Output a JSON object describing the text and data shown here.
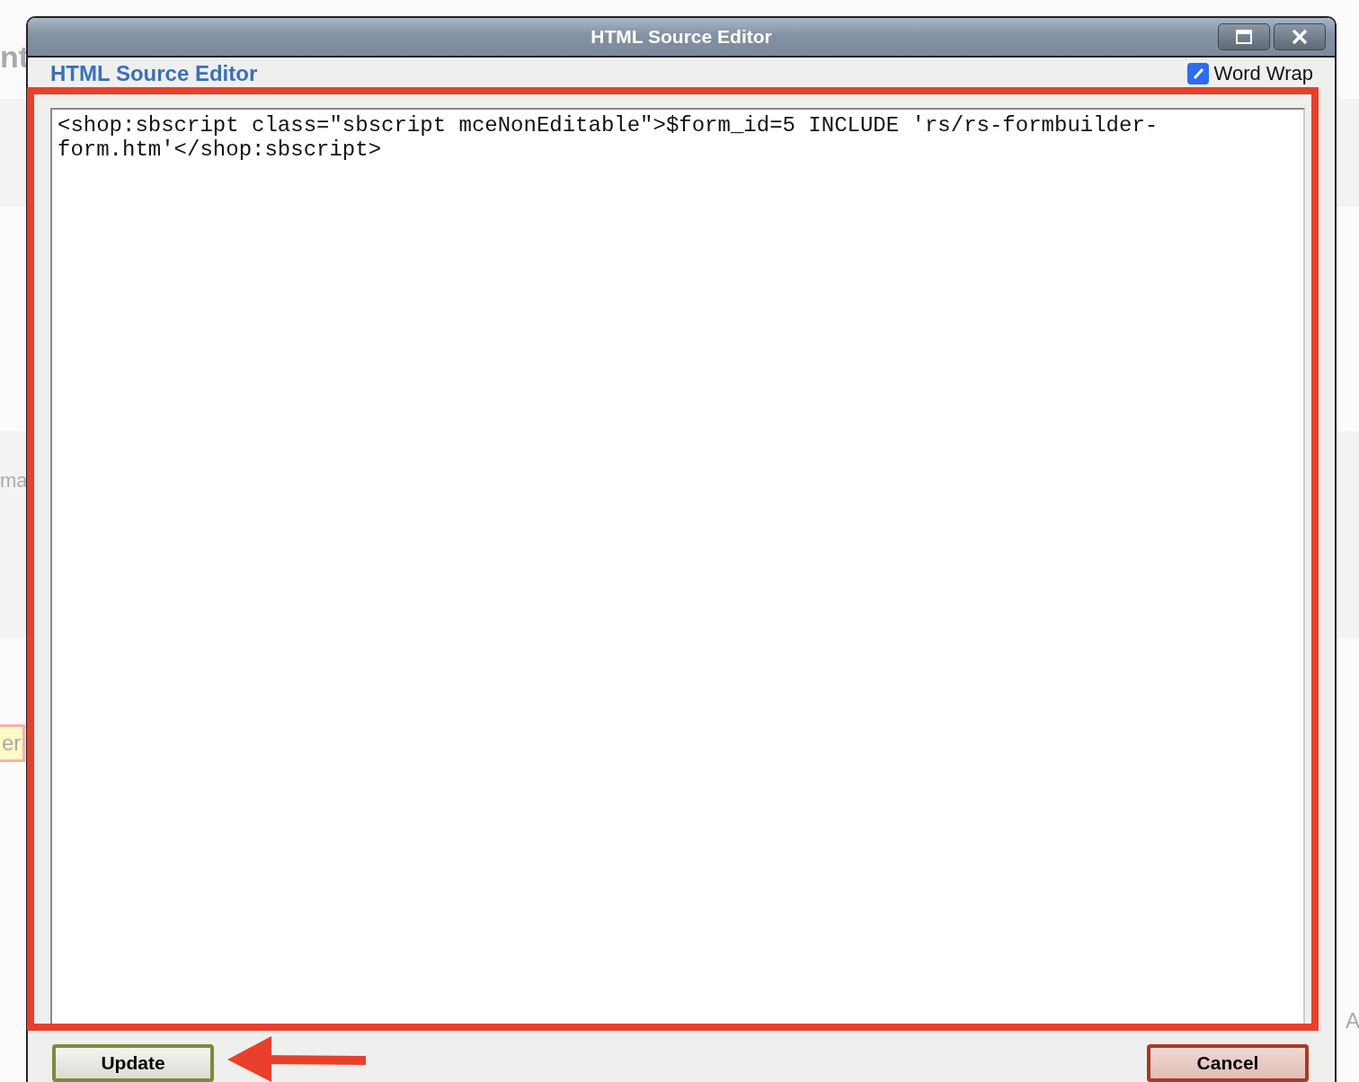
{
  "background_fragments": [
    {
      "text": "nt"
    },
    {
      "text": "ma"
    },
    {
      "text": "er"
    },
    {
      "text": "A"
    }
  ],
  "window": {
    "title": "HTML Source Editor"
  },
  "heading": "HTML Source Editor",
  "word_wrap": {
    "label": "Word Wrap",
    "checked": true
  },
  "source": "<shop:sbscript class=\"sbscript mceNonEditable\">$form_id=5 INCLUDE 'rs/rs-formbuilder-form.htm'</shop:sbscript>",
  "buttons": [
    {
      "label": "Update",
      "kind": "confirm"
    },
    {
      "label": "Cancel",
      "kind": "cancel"
    }
  ]
}
